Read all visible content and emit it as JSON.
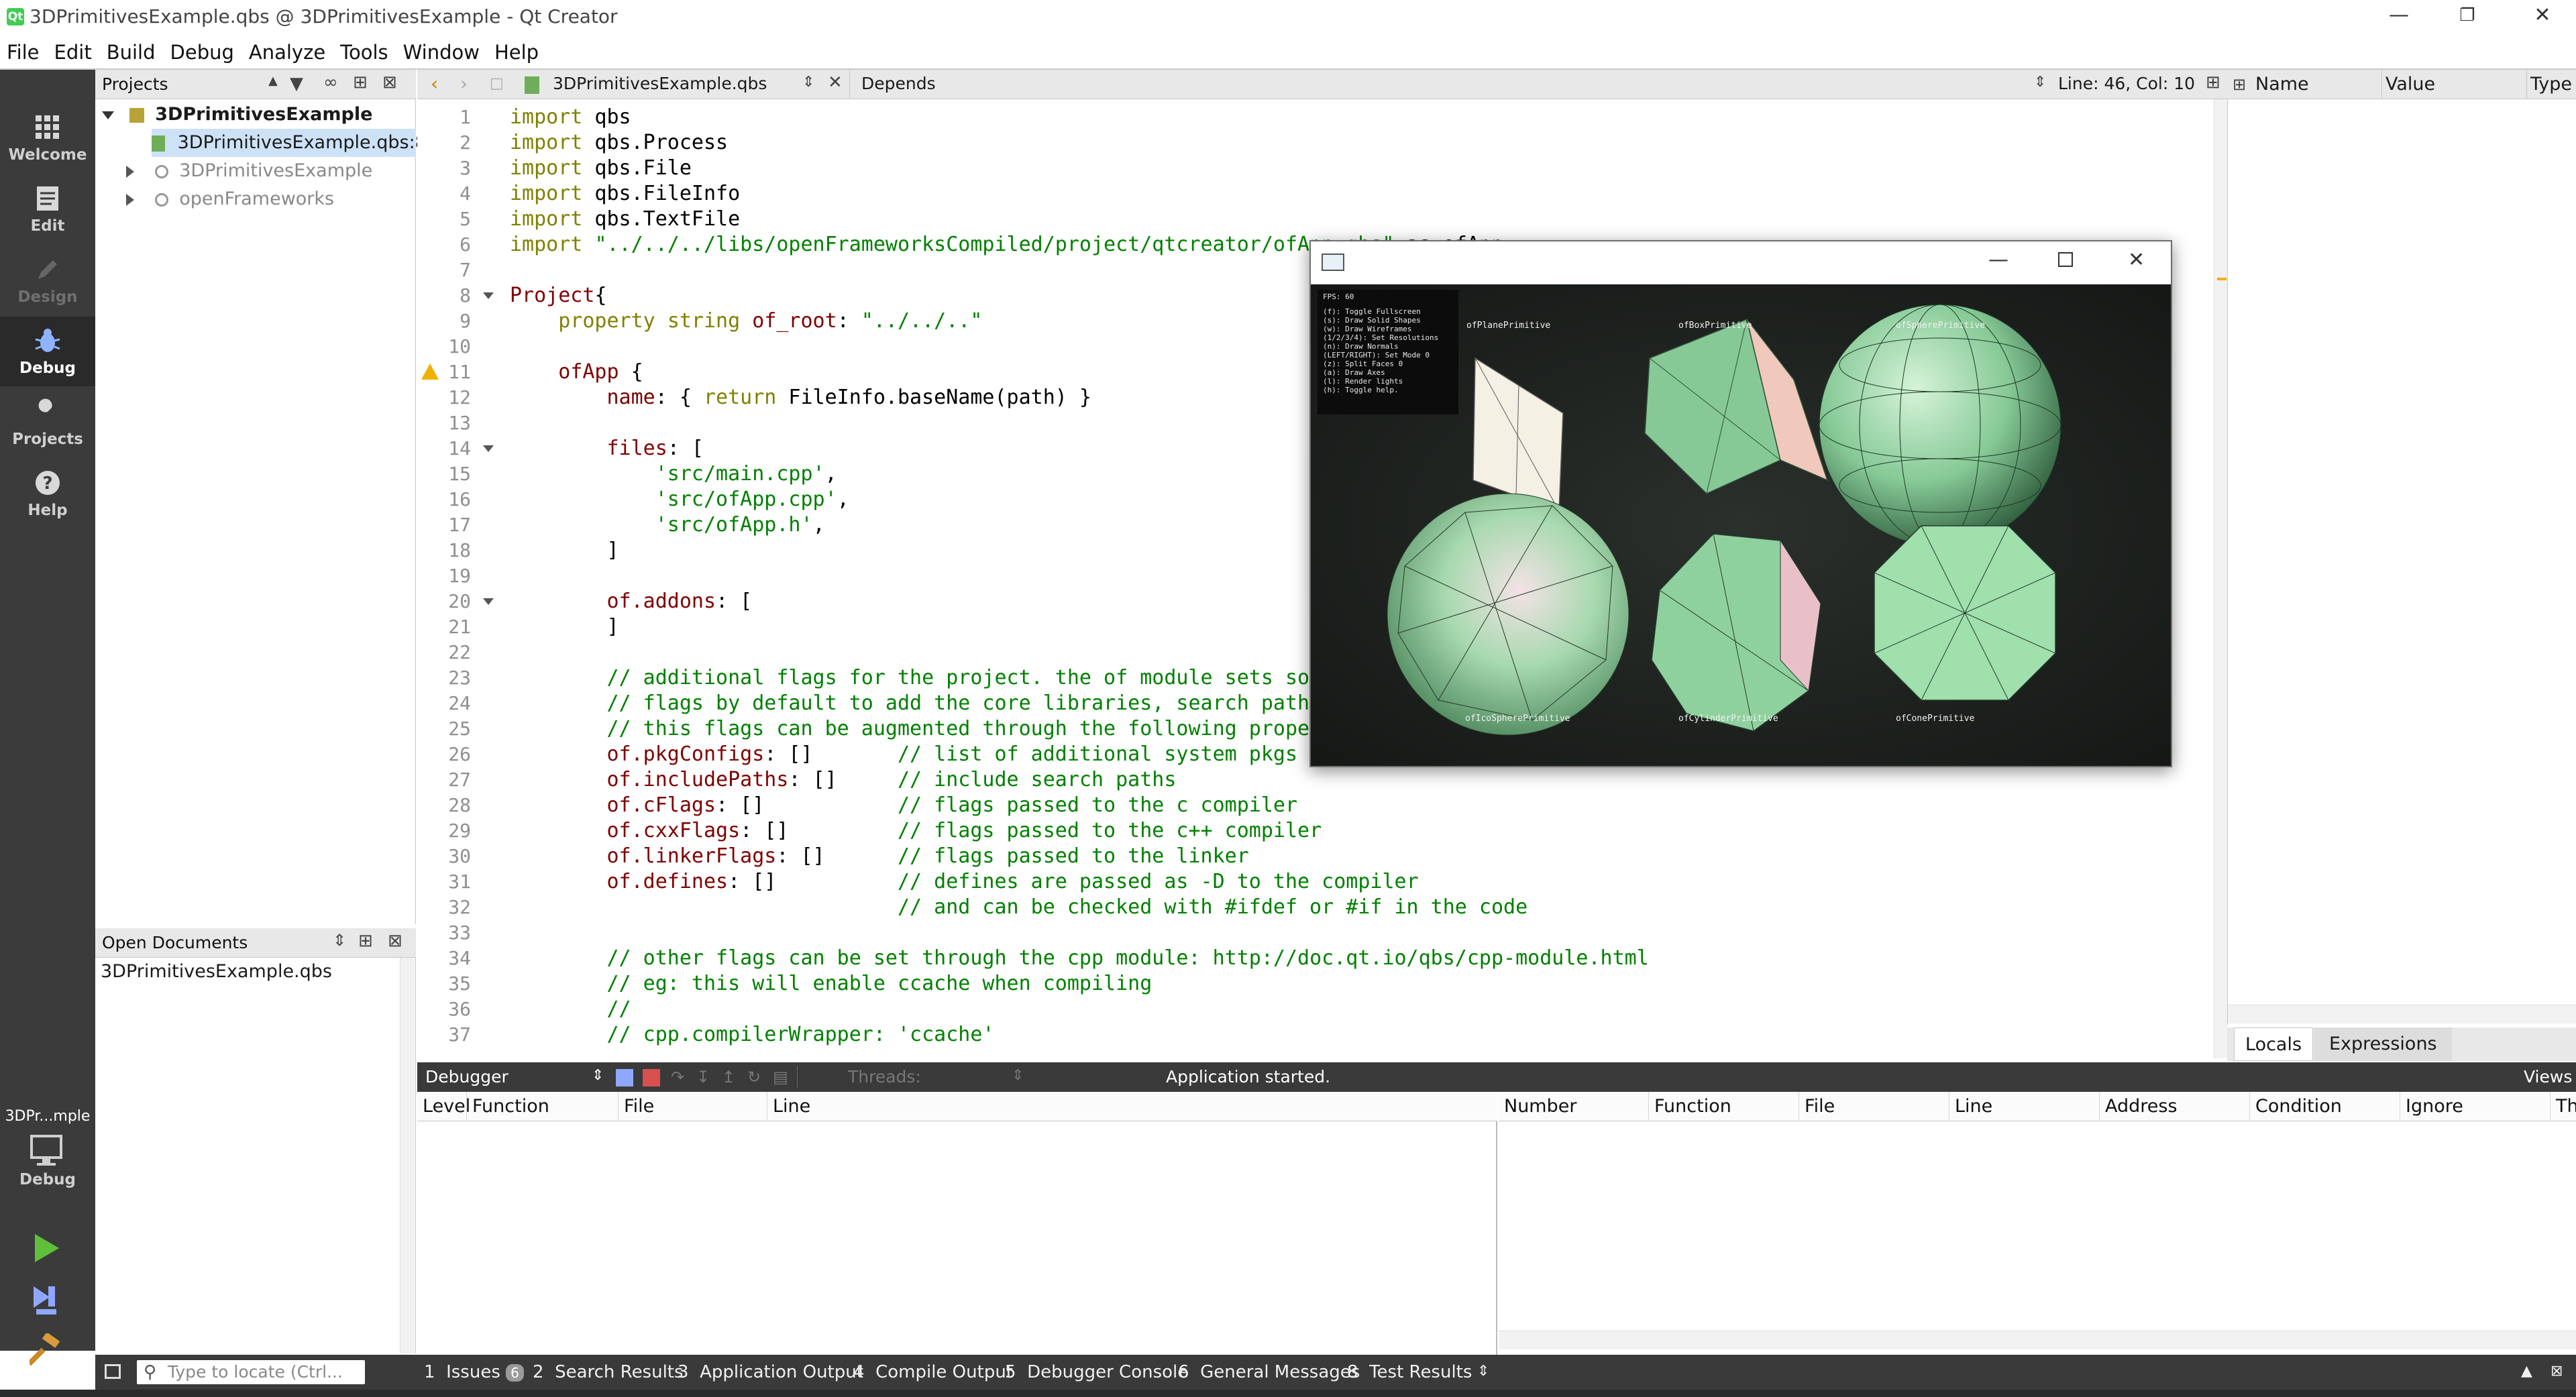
{
  "window": {
    "title": "3DPrimitivesExample.qbs @ 3DPrimitivesExample - Qt Creator",
    "controls": [
      "minimize",
      "restore",
      "close"
    ]
  },
  "menu": [
    "File",
    "Edit",
    "Build",
    "Debug",
    "Analyze",
    "Tools",
    "Window",
    "Help"
  ],
  "modes": [
    {
      "label": "Welcome",
      "icon": "grid-icon",
      "state": "normal"
    },
    {
      "label": "Edit",
      "icon": "document-icon",
      "state": "normal"
    },
    {
      "label": "Design",
      "icon": "pen-icon",
      "state": "disabled"
    },
    {
      "label": "Debug",
      "icon": "bug-icon",
      "state": "active"
    },
    {
      "label": "Projects",
      "icon": "wrench-icon",
      "state": "normal"
    },
    {
      "label": "Help",
      "icon": "help-icon",
      "state": "normal"
    }
  ],
  "kit": {
    "project": "3DPr...mple",
    "mode": "Debug"
  },
  "projects": {
    "header": "Projects",
    "tree": [
      {
        "label": "3DPrimitivesExample",
        "depth": 0,
        "expanded": true,
        "bold": true
      },
      {
        "label": "3DPrimitivesExample.qbs:8",
        "depth": 1,
        "selected": true
      },
      {
        "label": "3DPrimitivesExample",
        "depth": 1,
        "expanded": false,
        "dim": true
      },
      {
        "label": "openFrameworks",
        "depth": 1,
        "expanded": false,
        "dim": true
      }
    ]
  },
  "open_documents": {
    "header": "Open Documents",
    "items": [
      "3DPrimitivesExample.qbs"
    ]
  },
  "editor": {
    "file": "3DPrimitivesExample.qbs",
    "symbol": "Depends",
    "position": "Line: 46, Col: 10",
    "lines": [
      "import qbs",
      "import qbs.Process",
      "import qbs.File",
      "import qbs.FileInfo",
      "import qbs.TextFile",
      "import \"../../../libs/openFrameworksCompiled/project/qtcreator/ofApp.qbs\" as ofApp",
      "",
      "Project{",
      "    property string of_root: \"../../..\"",
      "",
      "    ofApp {",
      "        name: { return FileInfo.baseName(path) }",
      "",
      "        files: [",
      "            'src/main.cpp',",
      "            'src/ofApp.cpp',",
      "            'src/ofApp.h',",
      "        ]",
      "",
      "        of.addons: [",
      "        ]",
      "",
      "        // additional flags for the project. the of module sets some",
      "        // flags by default to add the core libraries, search paths...",
      "        // this flags can be augmented through the following properties:",
      "        of.pkgConfigs: []       // list of additional system pkgs to include",
      "        of.includePaths: []     // include search paths",
      "        of.cFlags: []           // flags passed to the c compiler",
      "        of.cxxFlags: []         // flags passed to the c++ compiler",
      "        of.linkerFlags: []      // flags passed to the linker",
      "        of.defines: []          // defines are passed as -D to the compiler",
      "                                // and can be checked with #ifdef or #if in the code",
      "",
      "        // other flags can be set through the cpp module: http://doc.qt.io/qbs/cpp-module.html",
      "        // eg: this will enable ccache when compiling",
      "        //",
      "        // cpp.compilerWrapper: 'ccache'"
    ],
    "warning_line": 11
  },
  "variables": {
    "columns": [
      "Name",
      "Value",
      "Type"
    ],
    "tabs": [
      "Locals",
      "Expressions"
    ]
  },
  "debugger": {
    "label": "Debugger",
    "threads_label": "Threads:",
    "status": "Application started.",
    "views": "Views",
    "stack_columns": [
      "Level",
      "Function",
      "File",
      "Line"
    ],
    "breakpoint_columns": [
      "Number",
      "Function",
      "File",
      "Line",
      "Address",
      "Condition",
      "Ignore",
      "Th"
    ]
  },
  "statusbar": {
    "locator_placeholder": "Type to locate (Ctrl...",
    "tabs": [
      {
        "num": "1",
        "label": "Issues",
        "badge": "6"
      },
      {
        "num": "2",
        "label": "Search Results"
      },
      {
        "num": "3",
        "label": "Application Output"
      },
      {
        "num": "4",
        "label": "Compile Output"
      },
      {
        "num": "5",
        "label": "Debugger Console"
      },
      {
        "num": "6",
        "label": "General Messages"
      },
      {
        "num": "8",
        "label": "Test Results"
      }
    ]
  },
  "app_window": {
    "fps": "FPS: 60",
    "help": [
      "(f): Toggle Fullscreen",
      "(s): Draw Solid Shapes",
      "(w): Draw Wireframes",
      "(1/2/3/4): Set Resolutions",
      "(n): Draw Normals",
      "(LEFT/RIGHT): Set Mode 0",
      "(z): Split Faces 0",
      "(a): Draw Axes",
      "(l): Render lights",
      "(h): Toggle help."
    ],
    "labels": [
      "ofPlanePrimitive",
      "ofBoxPrimitive",
      "ofSpherePrimitive",
      "ofIcoSpherePrimitive",
      "ofCylinderPrimitive",
      "ofConePrimitive"
    ]
  },
  "colors": {
    "mode_bar": "#3b3b3b",
    "keyword": "#808000",
    "string": "#008000",
    "comment": "#008000",
    "property": "#800000",
    "primitive_fill": "#8fd19e"
  }
}
